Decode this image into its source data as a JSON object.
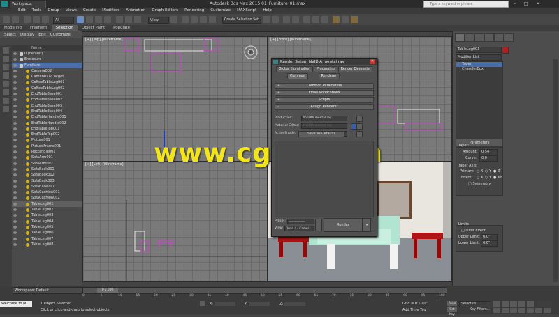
{
  "window": {
    "workspace": "Workspace: Default",
    "title": "Autodesk 3ds Max 2015    01_Furniture_01.max",
    "search_placeholder": "Type a keyword or phrase"
  },
  "menu": [
    "Edit",
    "Tools",
    "Group",
    "Views",
    "Create",
    "Modifiers",
    "Animation",
    "Graph Editors",
    "Rendering",
    "Customize",
    "MAXScript",
    "Help"
  ],
  "toolbar": {
    "view_dropdown": "View",
    "selection_set": "Create Selection Set"
  },
  "ribbon": {
    "tabs": [
      "Modeling",
      "Freeform",
      "Selection",
      "Object Paint",
      "Populate"
    ],
    "active": "Selection"
  },
  "explorer": {
    "tabs": [
      "Select",
      "Display",
      "Edit",
      "Customize"
    ],
    "column_header": "Name",
    "items": [
      {
        "label": "0 (default)",
        "indent": 1
      },
      {
        "label": "Enclosure",
        "indent": 1
      },
      {
        "label": "Furniture",
        "indent": 1,
        "selected": true
      },
      {
        "label": "Camera002",
        "indent": 2
      },
      {
        "label": "Camera002.Target",
        "indent": 2
      },
      {
        "label": "CoffeeTableLeg001",
        "indent": 2
      },
      {
        "label": "CoffeeTableLeg002",
        "indent": 2
      },
      {
        "label": "EndTableBase001",
        "indent": 2
      },
      {
        "label": "EndTableBase002",
        "indent": 2
      },
      {
        "label": "EndTableBase003",
        "indent": 2
      },
      {
        "label": "EndTableBase004",
        "indent": 2
      },
      {
        "label": "EndTableHandle001",
        "indent": 2
      },
      {
        "label": "EndTableHandle002",
        "indent": 2
      },
      {
        "label": "EndTableTop001",
        "indent": 2
      },
      {
        "label": "EndTableTop002",
        "indent": 2
      },
      {
        "label": "Picture001",
        "indent": 2
      },
      {
        "label": "PictureFrame001",
        "indent": 2
      },
      {
        "label": "Rectangle001",
        "indent": 2
      },
      {
        "label": "SofaArm001",
        "indent": 2
      },
      {
        "label": "SofaArm002",
        "indent": 2
      },
      {
        "label": "SofaBack001",
        "indent": 2
      },
      {
        "label": "SofaBack002",
        "indent": 2
      },
      {
        "label": "SofaBack003",
        "indent": 2
      },
      {
        "label": "SofaBase001",
        "indent": 2
      },
      {
        "label": "SofaCushion001",
        "indent": 2
      },
      {
        "label": "SofaCushion002",
        "indent": 2
      },
      {
        "label": "TableLeg001",
        "indent": 2,
        "highlight": true
      },
      {
        "label": "TableLeg002",
        "indent": 2
      },
      {
        "label": "TableLeg003",
        "indent": 2
      },
      {
        "label": "TableLeg004",
        "indent": 2
      },
      {
        "label": "TableLeg005",
        "indent": 2
      },
      {
        "label": "TableLeg006",
        "indent": 2
      },
      {
        "label": "TableLeg007",
        "indent": 2
      },
      {
        "label": "TableLeg008",
        "indent": 2
      }
    ]
  },
  "viewports": {
    "top": "[+] [Top] [Wireframe]",
    "left": "[+] [Left] [Wireframe]",
    "front": "[+] [Front] [Wireframe]"
  },
  "render_setup": {
    "title": "Render Setup: NVIDIA mental ray",
    "tabs_row1": [
      "Global Illumination",
      "Processing",
      "Render Elements"
    ],
    "tabs_row2": [
      "Common",
      "Renderer"
    ],
    "rollouts": [
      "Common Parameters",
      "Email Notifications",
      "Scripts",
      "Assign Renderer"
    ],
    "production_label": "Production:",
    "production_value": "NVIDIA mental ray",
    "material_editor_label": "Material Editor:",
    "material_editor_value": "NVIDIA mental ray",
    "activeshade_label": "ActiveShade:",
    "activeshade_value": "Default Scanline Renderer",
    "save_defaults": "Save as Defaults",
    "preset_label": "Preset:",
    "preset_value": "----------------",
    "view_label": "View:",
    "view_value": "Quad 4 - Camer",
    "render_button": "Render"
  },
  "command_panel": {
    "object_name": "TableLeg001",
    "modifier_list": "Modifier List",
    "stack": [
      "Taper",
      "ChamferBox"
    ],
    "parameters_title": "Parameters",
    "taper_label": "Taper:",
    "amount_label": "Amount:",
    "amount_value": "0.54",
    "curve_label": "Curve:",
    "curve_value": "0.0",
    "taper_axis_label": "Taper Axis:",
    "primary_label": "Primary:",
    "effect_label": "Effect:",
    "axis_primary": [
      "X",
      "Y",
      "Z"
    ],
    "axis_effect": [
      "X",
      "Y",
      "XY"
    ],
    "symmetry_label": "Symmetry",
    "limits_label": "Limits",
    "limit_effect_label": "Limit Effect",
    "upper_limit_label": "Upper Limit:",
    "upper_limit_value": "0.0\"",
    "lower_limit_label": "Lower Limit:",
    "lower_limit_value": "0.0\""
  },
  "status": {
    "workspace": "Workspace: Default",
    "maxscript": "Welcome to M",
    "objects_selected": "1 Object Selected",
    "prompt": "Click or click-and-drag to select objects",
    "timeline": "0 / 100",
    "ticks": [
      "0",
      "5",
      "10",
      "15",
      "20",
      "25",
      "30",
      "35",
      "40",
      "45",
      "50",
      "55",
      "60",
      "65",
      "70",
      "75",
      "80",
      "85",
      "90",
      "95",
      "100"
    ],
    "grid": "Grid = 0'10.0\"",
    "add_time_tag": "Add Time Tag",
    "auto_key": "Auto Key",
    "set_key": "Set Key",
    "selected": "Selected",
    "key_filters": "Key Filters..."
  },
  "watermark": "www.cgtsj.com",
  "colors": {
    "selection_blue": "#4a6ea9",
    "watermark_yellow": "#f2e51a",
    "furniture_red": "#b01212",
    "sofa_teal": "#a8dcc8"
  }
}
